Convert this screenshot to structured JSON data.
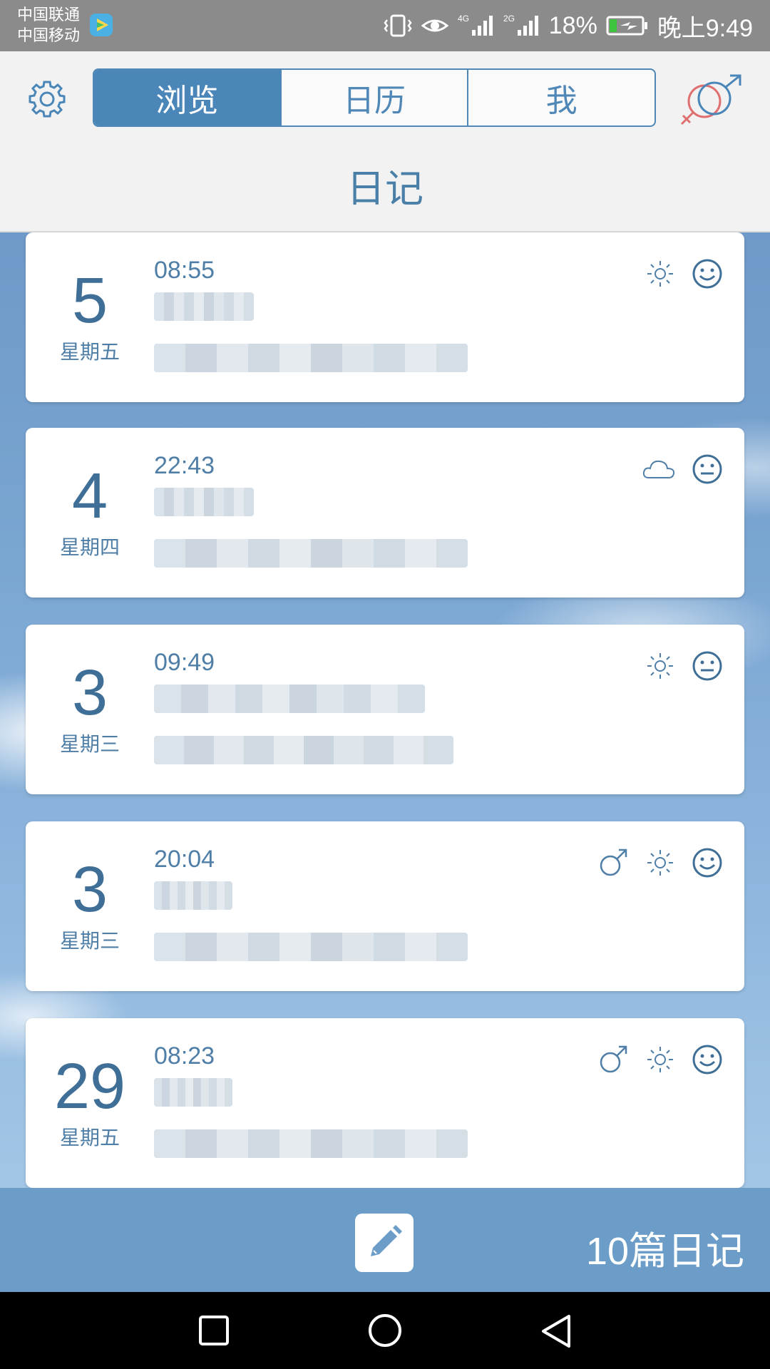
{
  "status_bar": {
    "carrier_top": "中国联通",
    "carrier_bottom": "中国移动",
    "network_4g": "4G",
    "network_2g": "2G",
    "battery": "18%",
    "time": "晚上9:49"
  },
  "header": {
    "tabs": [
      "浏览",
      "日历",
      "我"
    ],
    "active_tab": "浏览",
    "title": "日记"
  },
  "entries": [
    {
      "day": "5",
      "weekday": "星期五",
      "time": "08:55",
      "icons": [
        "sun-icon",
        "smile-icon"
      ]
    },
    {
      "day": "4",
      "weekday": "星期四",
      "time": "22:43",
      "icons": [
        "cloud-icon",
        "neutral-face-icon"
      ]
    },
    {
      "day": "3",
      "weekday": "星期三",
      "time": "09:49",
      "icons": [
        "sun-icon",
        "neutral-face-icon"
      ]
    },
    {
      "day": "3",
      "weekday": "星期三",
      "time": "20:04",
      "icons": [
        "male-icon",
        "sun-icon",
        "smile-icon"
      ]
    },
    {
      "day": "29",
      "weekday": "星期五",
      "time": "08:23",
      "icons": [
        "male-icon",
        "sun-icon",
        "smile-icon"
      ]
    }
  ],
  "footer": {
    "count_label": "10篇日记"
  },
  "colors": {
    "accent": "#4a86b8",
    "bottom_bar": "#6c9dc8"
  }
}
